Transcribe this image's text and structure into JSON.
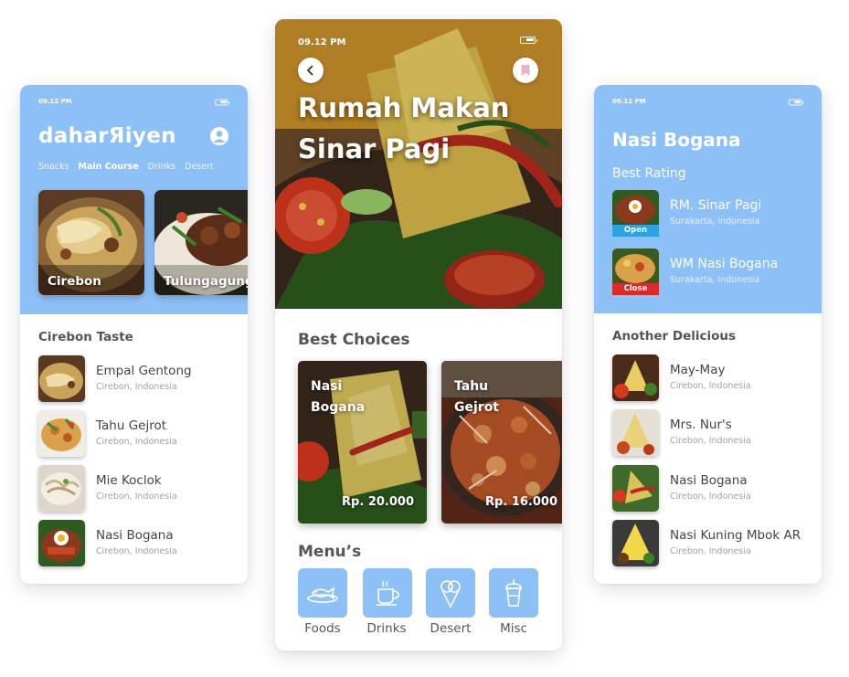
{
  "left_screen": {
    "status_time": "09.12 PM",
    "brand": "daharЯiyen",
    "tabs": [
      {
        "label": "Snacks",
        "active": false
      },
      {
        "label": "Main Course",
        "active": true
      },
      {
        "label": "Drinks",
        "active": false
      },
      {
        "label": "Desert",
        "active": false
      }
    ],
    "featured": [
      "Cirebon",
      "Tulungagung"
    ],
    "section_title": "Cirebon Taste",
    "items": [
      {
        "name": "Empal Gentong",
        "location": "Cirebon, Indonesia"
      },
      {
        "name": "Tahu Gejrot",
        "location": "Cirebon, Indonesia"
      },
      {
        "name": "Mie Koclok",
        "location": "Cirebon, Indonesia"
      },
      {
        "name": "Nasi Bogana",
        "location": "Cirebon, Indonesia"
      }
    ]
  },
  "center_screen": {
    "status_time": "09.12 PM",
    "title_line1": "Rumah Makan",
    "title_line2": "Sinar Pagi",
    "best_choices_title": "Best Choices",
    "choices": [
      {
        "name": "Nasi Bogana",
        "price": "Rp. 20.000"
      },
      {
        "name": "Tahu Gejrot",
        "price": "Rp. 16.000"
      }
    ],
    "menu_title": "Menu’s",
    "menu": [
      {
        "label": "Foods",
        "icon": "fish-plate-icon"
      },
      {
        "label": "Drinks",
        "icon": "coffee-cup-icon"
      },
      {
        "label": "Desert",
        "icon": "ice-cream-icon"
      },
      {
        "label": "Misc",
        "icon": "drink-cup-icon"
      }
    ]
  },
  "right_screen": {
    "status_time": "09.12 PM",
    "title": "Nasi Bogana",
    "best_rating_title": "Best Rating",
    "rated": [
      {
        "name": "RM. Sinar Pagi",
        "location": "Surakarta, Indonesia",
        "status": "Open",
        "status_color": "#2aa3e0"
      },
      {
        "name": "WM Nasi Bogana",
        "location": "Surakarta, Indonesia",
        "status": "Close",
        "status_color": "#d92b2b"
      }
    ],
    "section_title": "Another Delicious",
    "items": [
      {
        "name": "May-May",
        "location": "Cirebon, Indonesia"
      },
      {
        "name": "Mrs. Nur's",
        "location": "Cirebon, Indonesia"
      },
      {
        "name": "Nasi Bogana",
        "location": "Cirebon, Indonesia"
      },
      {
        "name": "Nasi Kuning Mbok AR",
        "location": "Cirebon, Indonesia"
      }
    ]
  },
  "colors": {
    "accent": "#8ec0f8"
  }
}
